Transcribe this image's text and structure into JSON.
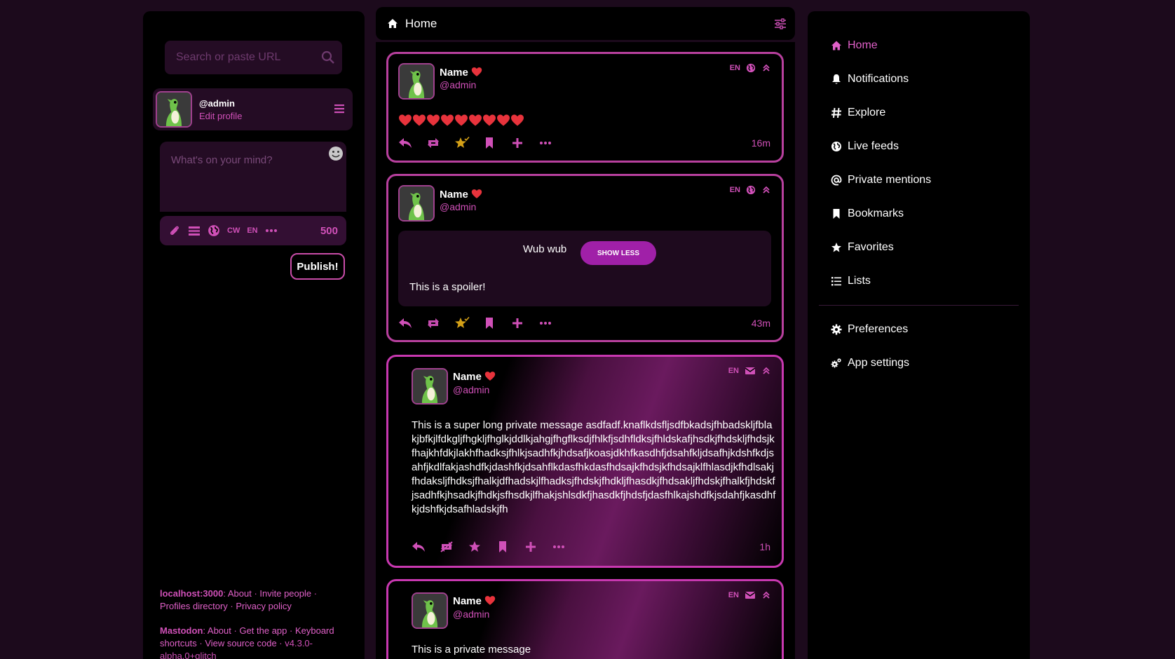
{
  "search": {
    "placeholder": "Search or paste URL"
  },
  "profile": {
    "handle": "@admin",
    "edit_label": "Edit profile"
  },
  "compose": {
    "placeholder": "What's on your mind?",
    "cw_label": "CW",
    "lang_label": "EN",
    "char_count": "500",
    "publish_label": "Publish!"
  },
  "footer": {
    "instance_label": "localhost:3000",
    "instance_links": [
      "About",
      "Invite people",
      "Profiles directory",
      "Privacy policy"
    ],
    "mastodon_label": "Mastodon",
    "mastodon_links": [
      "About",
      "Get the app",
      "Keyboard shortcuts",
      "View source code"
    ],
    "version": "v4.3.0-alpha.0+glitch"
  },
  "column": {
    "title": "Home"
  },
  "posts": [
    {
      "name": "Name",
      "handle": "@admin",
      "lang": "EN",
      "visibility_icon": "globe-icon",
      "content_hearts": 9,
      "time": "16m"
    },
    {
      "name": "Name",
      "handle": "@admin",
      "lang": "EN",
      "visibility_icon": "globe-icon",
      "spoiler_text": "Wub wub",
      "toggle_label": "SHOW LESS",
      "content": "This is a spoiler!",
      "time": "43m"
    },
    {
      "name": "Name",
      "handle": "@admin",
      "lang": "EN",
      "visibility_icon": "envelope-icon",
      "content": "This is a super long private message asdfadf.knaflkdsfljsdfbkadsjfhbadskljfblakjbfkjlfdkgljfhgkljfhglkjddlkjahgjfhgflksdjfhlkfjsdhfldksjfhldskafjhsdkjfhdskljfhdsjkfhajkhfdkjlakhfhadksjfhlkjsadhfkjhdsafjkoasjdkhfkasdhfjdsahfkljdsafhjkdshfkdjsahfjkdlfakjashdfkjdashfkjdsahflkdasfhkdasfhdsajkfhdsjkfhdsajklfhlasdjkfhdlsakjfhdaksljfhdksjfhalkjdfhadskjlfhadksjfhdskjfhdkljfhasdkjfhdsakljfhdskjfhalkfjhdskfjsadhfkjhsadkjfhdkjsfhsdkjlfhakjshlsdkfjhasdkfjhdsfjdasfhlkajshdfkjsdahfjkasdhfkjdshfkjdsafhladskjfh",
      "time": "1h"
    },
    {
      "name": "Name",
      "handle": "@admin",
      "lang": "EN",
      "visibility_icon": "envelope-icon",
      "content": "This is a private message"
    }
  ],
  "nav": {
    "items": [
      {
        "label": "Home",
        "icon": "home-icon",
        "active": true
      },
      {
        "label": "Notifications",
        "icon": "bell-icon"
      },
      {
        "label": "Explore",
        "icon": "hashtag-icon"
      },
      {
        "label": "Live feeds",
        "icon": "globe-icon"
      },
      {
        "label": "Private mentions",
        "icon": "at-icon"
      },
      {
        "label": "Bookmarks",
        "icon": "bookmark-icon"
      },
      {
        "label": "Favorites",
        "icon": "star-icon"
      },
      {
        "label": "Lists",
        "icon": "list-icon"
      }
    ],
    "secondary": [
      {
        "label": "Preferences",
        "icon": "gear-icon"
      },
      {
        "label": "App settings",
        "icon": "gears-icon"
      }
    ]
  },
  "colors": {
    "accent": "#d050b8",
    "border": "#b8409e",
    "button": "#a020a8",
    "favorite": "#d4a017",
    "heart": "#e8333c"
  }
}
